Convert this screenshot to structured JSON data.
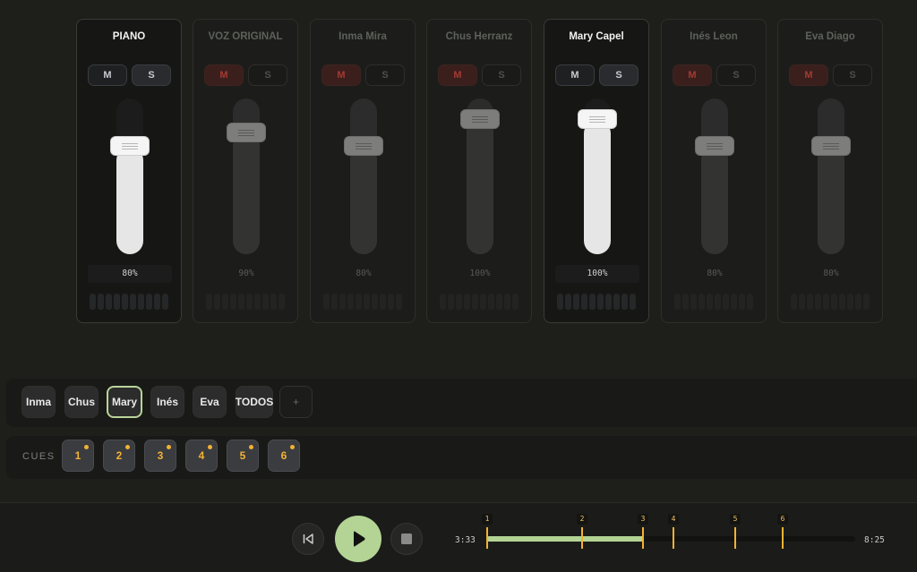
{
  "channels": [
    {
      "name": "PIANO",
      "mute": "M",
      "solo": "S",
      "muted": false,
      "active": true,
      "level": 0.8,
      "volume": "80%"
    },
    {
      "name": "VOZ ORIGINAL",
      "mute": "M",
      "solo": "S",
      "muted": true,
      "active": false,
      "level": 0.9,
      "volume": "90%"
    },
    {
      "name": "Inma Mira",
      "mute": "M",
      "solo": "S",
      "muted": true,
      "active": false,
      "level": 0.8,
      "volume": "80%"
    },
    {
      "name": "Chus Herranz",
      "mute": "M",
      "solo": "S",
      "muted": true,
      "active": false,
      "level": 1.0,
      "volume": "100%"
    },
    {
      "name": "Mary Capel",
      "mute": "M",
      "solo": "S",
      "muted": false,
      "active": true,
      "level": 1.0,
      "volume": "100%"
    },
    {
      "name": "Inés Leon",
      "mute": "M",
      "solo": "S",
      "muted": true,
      "active": false,
      "level": 0.8,
      "volume": "80%"
    },
    {
      "name": "Eva Diago",
      "mute": "M",
      "solo": "S",
      "muted": true,
      "active": false,
      "level": 0.8,
      "volume": "80%"
    }
  ],
  "groups": {
    "items": [
      "Inma",
      "Chus",
      "Mary",
      "Inés",
      "Eva",
      "TODOS"
    ],
    "selected": "Mary",
    "add_label": "+"
  },
  "cues": {
    "label": "CUES",
    "items": [
      "1",
      "2",
      "3",
      "4",
      "5",
      "6"
    ]
  },
  "transport": {
    "current_time": "3:33",
    "total_time": "8:25",
    "markers": [
      {
        "label": "1",
        "time": "0:00"
      },
      {
        "label": "2",
        "time": "2:10"
      },
      {
        "label": "3",
        "time": "3:33"
      },
      {
        "label": "4",
        "time": "4:15"
      },
      {
        "label": "5",
        "time": "5:40"
      },
      {
        "label": "6",
        "time": "6:44"
      }
    ]
  },
  "colors": {
    "accent_green": "#b3d494",
    "cue_orange": "#f2b233",
    "mute_red": "#a43a32",
    "background": "#1e1f1b"
  }
}
